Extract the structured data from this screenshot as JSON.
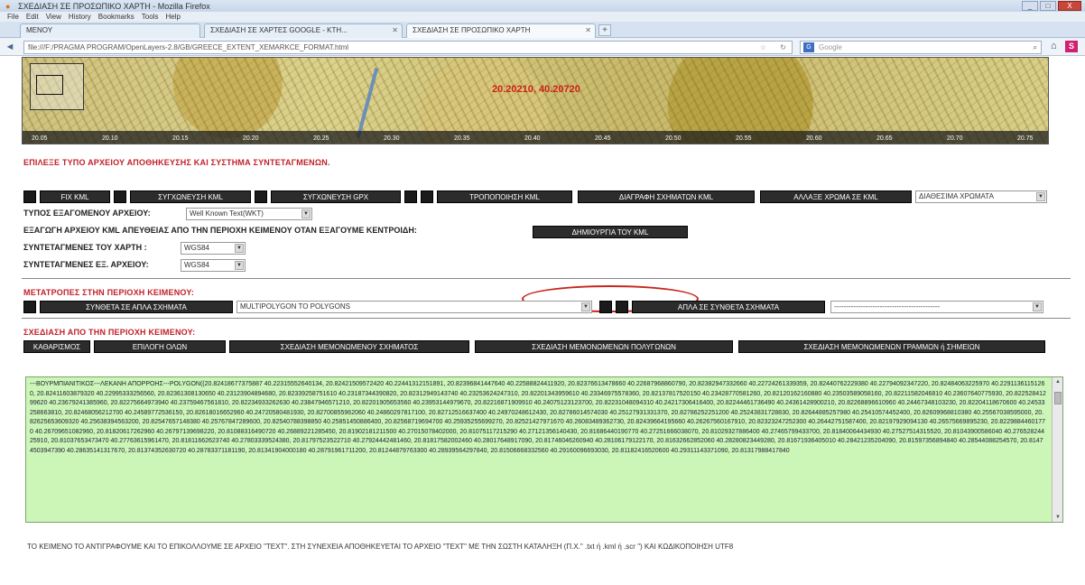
{
  "window": {
    "title": "ΣΧΕΔΙΑΣΗ ΣΕ ΠΡΟΣΩΠΙΚΟ ΧΑΡΤΗ - Mozilla Firefox",
    "controls": [
      "_",
      "□",
      "X"
    ]
  },
  "menubar": [
    "File",
    "Edit",
    "View",
    "History",
    "Bookmarks",
    "Tools",
    "Help"
  ],
  "tabs": [
    {
      "label": "ΜΕΝΟΥ"
    },
    {
      "label": "ΣΧΕΔΙΑΣΗ ΣΕ ΧΑΡΤΕΣ GOOGLE - KTH..."
    },
    {
      "label": "ΣΧΕΔΙΑΣΗ ΣΕ ΠΡΟΣΩΠΙΚΟ ΧΑΡΤΗ"
    }
  ],
  "newtab": "+",
  "nav": {
    "url": "file:///F:/PRAGMA PROGRAM/OpenLayers-2.8/GB/GREECE_EXTENT_XEMARKCE_FORMAT.html",
    "search_placeholder": "Google",
    "search_engine": "G"
  },
  "map": {
    "coords_label": "20.20210, 40.20720",
    "scale_ticks": [
      "20.05",
      "20.10",
      "20.15",
      "20.20",
      "20.25",
      "20.30",
      "20.35",
      "20.40",
      "20.45",
      "20.50",
      "20.55",
      "20.60",
      "20.65",
      "20.70",
      "20.75"
    ]
  },
  "headings": {
    "select_type": "ΕΠΙΛΕΞΕ ΤΥΠΟ ΑΡΧΕΙΟΥ ΑΠΟΘΗΚΕΥΣΗΣ ΚΑΙ ΣΥΣΤΗΜΑ ΣΥΝΤΕΤΑΓΜΕΝΩΝ.",
    "conversions": "ΜΕΤΑΤΡΟΠΕΣ ΣΤΗΝ ΠΕΡΙΟΧΗ ΚΕΙΜΕΝΟΥ:",
    "draw_from": "ΣΧΕΔΙΑΣΗ ΑΠΟ ΤΗΝ ΠΕΡΙΟΧΗ ΚΕΙΜΕΝΟΥ:"
  },
  "toolbar1": {
    "fix_kml": "FIX KML",
    "merge_kml": "ΣΥΓΧΩΝΕΥΣΗ KML",
    "merge_gpx": "ΣΥΓΧΩΝΕΥΣΗ GPX",
    "modify_kml": "ΤΡΟΠΟΠΟΙΗΣΗ KML",
    "delete_kml": "ΔΙΑΓΡΑΦΗ ΣΧΗΜΑΤΩΝ KML",
    "change_color": "ΑΛΛΑΞΕ ΧΡΩΜΑ ΣΕ KML",
    "colors_select": "ΔΙΑΘΕΣΙΜΑ ΧΡΩΜΑΤΑ"
  },
  "form": {
    "export_type_label": "ΤΥΠΟΣ ΕΞΑΓΟΜΕΝΟΥ ΑΡΧΕΙΟΥ:",
    "export_type_value": "Well Known Text(WKT)",
    "export_kml_label": "ΕΞΑΓΩΓΗ ΑΡΧΕΙΟΥ KML ΑΠΕΥΘΕΙΑΣ ΑΠΟ ΤΗΝ ΠΕΡΙΟΧΗ ΚΕΙΜΕΝΟΥ ΟΤΑΝ ΕΞΑΓΟΥΜΕ ΚΕΝΤΡΟΙΔΗ:",
    "create_kml": "ΔΗΜΙΟΥΡΓΙΑ ΤΟΥ KML",
    "map_coords_label": "ΣΥΝΤΕΤΑΓΜΕΝΕΣ ΤΟΥ ΧΑΡΤΗ :",
    "map_coords_value": "WGS84",
    "file_coords_label": "ΣΥΝΤΕΤΑΓΜΕΝΕΣ ΕΞ. ΑΡΧΕΙΟΥ:",
    "file_coords_value": "WGS84"
  },
  "conversions": {
    "to_simple": "ΣΥΝΘΕΤΑ ΣΕ ΑΠΛΑ ΣΧΗΜΑΤΑ",
    "select_value": "MULTIPOLYGON TO POLYGONS",
    "to_complex": "ΑΠΛΑ ΣΕ ΣΥΝΘΕΤΑ ΣΧΗΜΑΤΑ",
    "second_select_value": "--------------------------------------------"
  },
  "draw_buttons": {
    "clear": "ΚΑΘΑΡΙΣΜΟΣ",
    "select_all": "ΕΠΙΛΟΓΗ ΟΛΩΝ",
    "draw_single": "ΣΧΕΔΙΑΣΗ ΜΕΜΟΝΩΜΕΝΟΥ ΣΧΗΜΑΤΟΣ",
    "draw_polygons": "ΣΧΕΔΙΑΣΗ ΜΕΜΟΝΩΜΕΝΩΝ ΠΟΛΥΓΩΝΩΝ",
    "draw_lines": "ΣΧΕΔΙΑΣΗ ΜΕΜΟΝΩΜΕΝΩΝ ΓΡΑΜΜΩΝ ή ΣΗΜΕΙΩΝ"
  },
  "textarea_content": "---ΒΟΥΡΜΠΙΑΝΙΤΙΚΟΣ---ΛΕΚΑΝΗ ΑΠΟΡΡΟΗΣ---POLYGON((20.82418677375887 40.22315552640134, 20.82421509572420 40.22441312151891, 20.82396841447640 40.22588824411920, 20.82376613478660 40.22687968860790, 20.82382947332660 40.22724261339359, 20.82440762229380 40.22794092347220, 20.82484063225970 40.22911361151260, 20.82411603879320 40.22995333256560, 20.82361308130650 40.23123904894680, 20.82339258751610 40.23187344390820, 20.82312949143740 40.23253624247310, 20.82201343959610 40.23346975578360, 20.82137817520150 40.23428770581260, 20.82120162160880 40.23503589058160, 20.82211582046810 40.23607640775930, 20.82252841299620 40.23679241385960, 20.82275664973940 40.23759467561810, 20.82234933262630 40.23847946571210, 20.82201905653560 40.23953144979670, 20.82216871909910 40.24075123123700, 20.82231048094310 40.24217306416400, 20.82244461736490 40.24361428900210, 20.82268896610960 40.24467348103230, 20.82204118670600 40.24533258663810, 20.82468056212700 40.24589772536150, 20.82618016652960 40.24720580481930, 20.82700855962060 40.24860297817100, 20.82712516637400 40.24970248612430, 20.82786014574030 40.25127931331370, 20.82786252251200 40.25243831728830, 20.82644885257980 40.25410574452400, 20.82609968810380 40.25567038595000, 20.82625653609320 40.25638394563200, 20.82547657148380 40.25767847289600, 20.82540788398850 40.25851450886400, 20.82568719694700 40.25935255699270, 20.82521427971670 40.26083489362730, 20.82439664195660 40.26267560167910, 20.82323247252300 40.26442751587400, 20.82197929094130 40.26575669895230, 20.82298844601770 40.26709651082960, 20.81820617262960 40.26797139698220, 20.81088316490720 40.26889221285450, 20.81902181211500 40.27015078402000, 20.81075117215290 40.27121356140430, 20.81686440190770 40.27251666038070, 20.81029327886400 40.27465799433700, 20.81840064434930 40.27527514315520, 20.81043900586040 40.27652824425910, 20.81037653473470 40.27763615961470, 20.81811662623740 40.27803339524380, 20.81797523522710 40.27924442481460, 20.81817582002460 40.28017648917090, 20.81746046260940 40.28106179122170, 20.81632662852060 40.28280823449280, 20.81671936405010 40.28421235204090, 20.81597356894840 40.28544088254570, 20.81474503947390 40.28635141317670, 20.81374352630720 40.28783371181190, 20.81341904000180 40.28791961711200, 20.81244879763300 40.28939564297840, 20.81506668332560 40.29160096693030, 20.81182416520600 40.29311143371090, 20.81317988417840",
  "scrollbar": {
    "up": "▲",
    "down": "▼"
  },
  "footer_note": "ΤΟ ΚΕΙΜΕΝΟ ΤΟ ΑΝΤΙΓΡΑΦΟΥΜΕ ΚΑΙ ΤΟ ΕΠΙΚΟΛΛΟΥΜΕ ΣΕ ΑΡΧΕΙΟ \"TEXT\". ΣΤΗ ΣΥΝΕΧΕΙΑ ΑΠΟΘΗΚΕΥΕΤΑΙ ΤΟ ΑΡΧΕΙΟ \"TEXT\" ΜΕ ΤΗΝ ΣΩΣΤΗ ΚΑΤΑΛΗΞΗ (Π.Χ.\" .txt ή .kml ή .scr \") ΚΑΙ ΚΩΔΙΚΟΠΟΙΗΣΗ UTF8",
  "colors": {
    "accent_red": "#c0202a",
    "button_dark": "#2c2c2c",
    "textarea_bg": "#ccf5b8"
  }
}
